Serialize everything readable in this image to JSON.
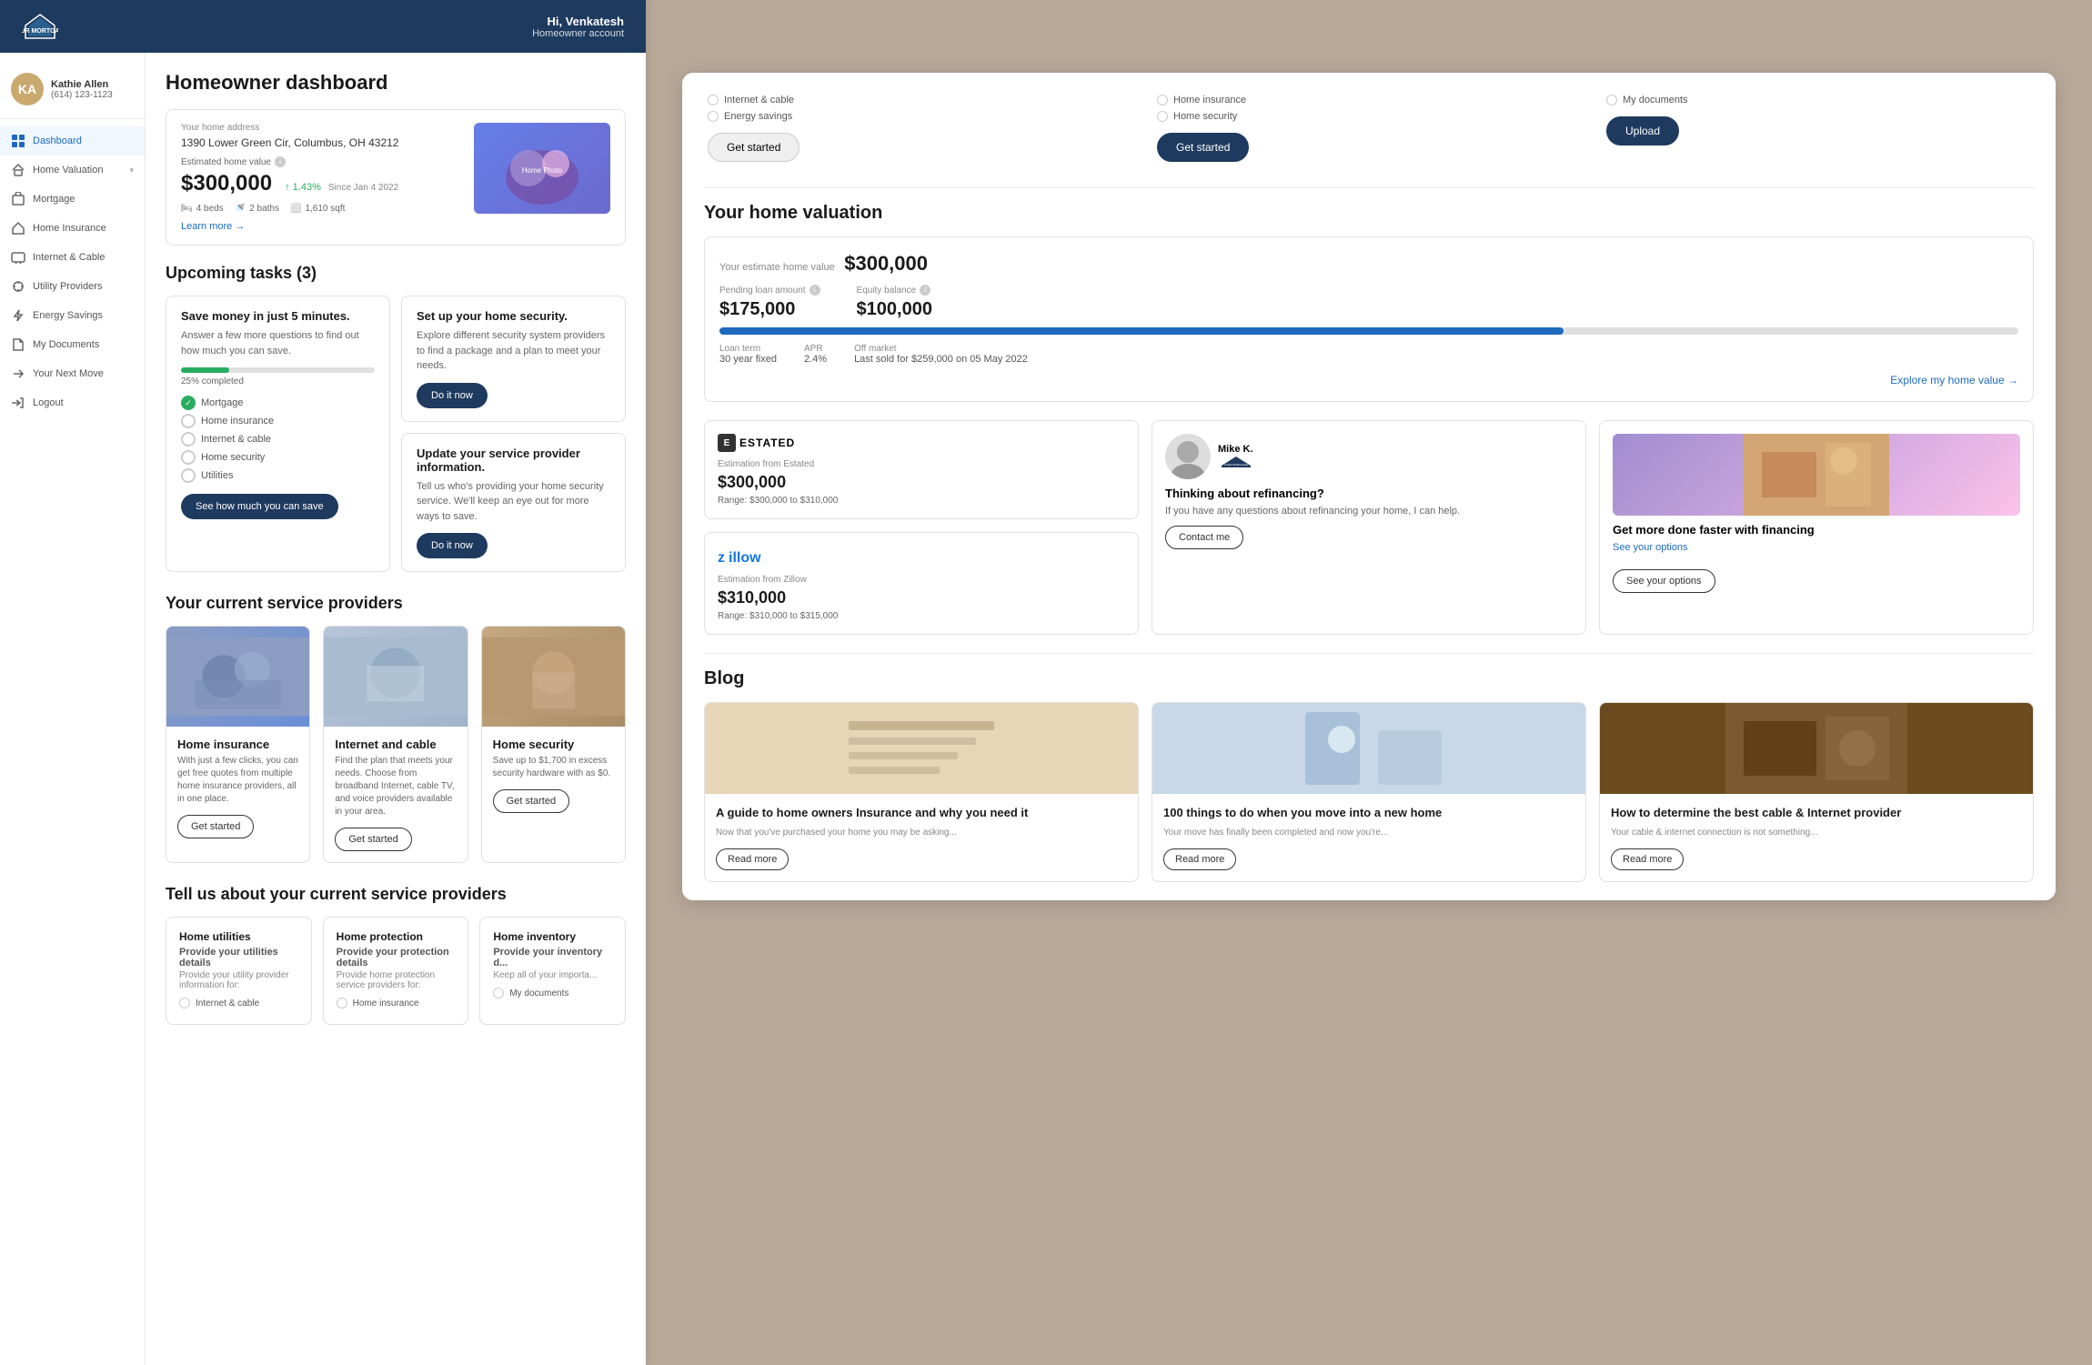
{
  "header": {
    "logo_text": "YOUR MORTGAGE",
    "greeting": "Hi, Venkatesh",
    "account_type": "Homeowner account"
  },
  "user": {
    "name": "Kathie Allen",
    "phone": "(614) 123-1123",
    "initials": "KA"
  },
  "nav": {
    "items": [
      {
        "id": "dashboard",
        "label": "Dashboard",
        "active": true
      },
      {
        "id": "home-valuation",
        "label": "Home Valuation",
        "has_chevron": true
      },
      {
        "id": "mortgage",
        "label": "Mortgage"
      },
      {
        "id": "home-insurance",
        "label": "Home Insurance"
      },
      {
        "id": "internet-cable",
        "label": "Internet & Cable"
      },
      {
        "id": "utility-providers",
        "label": "Utility Providers"
      },
      {
        "id": "energy-savings",
        "label": "Energy Savings"
      },
      {
        "id": "my-documents",
        "label": "My Documents"
      },
      {
        "id": "your-next-move",
        "label": "Your Next Move"
      },
      {
        "id": "logout",
        "label": "Logout"
      }
    ]
  },
  "dashboard": {
    "title": "Homeowner dashboard",
    "home": {
      "address_label": "Your home address",
      "address": "1390 Lower Green Cir, Columbus, OH 43212",
      "estimated_label": "Estimated home value",
      "value": "$300,000",
      "change": "1.43%",
      "change_direction": "up",
      "since": "Since Jan 4 2022",
      "beds": "4 beds",
      "baths": "2 baths",
      "sqft": "1,610 sqft",
      "learn_more": "Learn more →"
    },
    "tasks": {
      "section_title": "Upcoming tasks (3)",
      "card1": {
        "title": "Save money in just 5 minutes.",
        "desc": "Answer a few more questions to find out how much you can save.",
        "progress": 25,
        "progress_label": "25% completed",
        "checklist": [
          {
            "label": "Mortgage",
            "done": true
          },
          {
            "label": "Home insurance",
            "done": false
          },
          {
            "label": "Internet & cable",
            "done": false
          },
          {
            "label": "Home security",
            "done": false
          },
          {
            "label": "Utilities",
            "done": false
          }
        ],
        "cta": "See how much you can save"
      },
      "card2": {
        "title": "Set up your home security.",
        "desc": "Explore different security system providers to find a package and a plan to meet your needs.",
        "cta": "Do it now"
      },
      "card3": {
        "title": "Update your service provider information.",
        "desc": "Tell us who's providing your home security service. We'll keep an eye out for more ways to save.",
        "cta": "Do it now"
      }
    },
    "service_providers": {
      "section_title": "Your current service providers",
      "items": [
        {
          "name": "Home insurance",
          "desc": "With just a few clicks, you can get free quotes from multiple home insurance providers, all in one place.",
          "cta": "Get started",
          "color": "#8B9DC3"
        },
        {
          "name": "Internet and cable",
          "desc": "Find the plan that meets your needs. Choose from broadband Internet, cable TV, and voice providers available in your area.",
          "cta": "Get started",
          "color": "#B8C4D8"
        },
        {
          "name": "Home security",
          "desc": "Save up to $1,700 in excess security hardware with as $0.",
          "cta": "Get started",
          "color": "#C4A882"
        }
      ]
    },
    "tell_us": {
      "title": "Tell us about your current service providers",
      "cards": [
        {
          "title": "Home utilities",
          "subtitle": "Provide your utilities details",
          "desc": "Provide your utility provider information for:",
          "items": [
            "Internet & cable"
          ]
        },
        {
          "title": "Home protection",
          "subtitle": "Provide your protection details",
          "desc": "Provide home protection service providers for:",
          "items": [
            "Home insurance"
          ]
        },
        {
          "title": "Home inventory",
          "subtitle": "Provide your inventory d...",
          "desc": "Keep all of your importa...",
          "items": [
            "My documents"
          ]
        }
      ]
    }
  },
  "right_panel": {
    "top_services": [
      {
        "options": [
          "Internet & cable",
          "Energy savings"
        ],
        "cta": "Get started",
        "cta_style": "outline"
      },
      {
        "options": [
          "Home insurance",
          "Home security"
        ],
        "cta": "Get started",
        "cta_style": "dark"
      },
      {
        "options": [
          "My documents"
        ],
        "cta": "Upload",
        "cta_style": "dark"
      }
    ],
    "valuation": {
      "title": "Your home valuation",
      "estimate_label": "Your estimate home value",
      "estimate_value": "$300,000",
      "pending_loan_label": "Pending loan amount",
      "pending_loan": "$175,000",
      "equity_label": "Equity balance",
      "equity": "$100,000",
      "loan_term_label": "Loan term",
      "loan_term": "30 year fixed",
      "apr_label": "APR",
      "apr": "2.4%",
      "off_market_label": "Off market",
      "off_market": "Last sold for $259,000 on 05 May 2022",
      "explore_link": "Explore my home value →"
    },
    "sources": [
      {
        "logo": "ESTATED",
        "logo_color": "#333",
        "title": "Estimation from Estated",
        "value": "$300,000",
        "range": "Range: $300,000 to $310,000"
      },
      {
        "logo": "YOUR MORTGAGE",
        "logo_type": "advisor",
        "advisor_name": "Mike K.",
        "title": "Thinking about refinancing?",
        "desc": "If you have any questions about refinancing your home, I can help.",
        "cta": "Contact me"
      },
      {
        "logo": "financing",
        "title": "Get more done faster with financing",
        "desc": "See your options",
        "cta": "See your options"
      }
    ],
    "zillow": {
      "title": "Estimation from Zillow",
      "value": "$310,000",
      "range": "Range: $310,000 to $315,000"
    },
    "blog": {
      "title": "Blog",
      "articles": [
        {
          "title": "A guide to home owners Insurance and why you need it",
          "excerpt": "Now that you've purchased your home you may be asking...",
          "cta": "Read more",
          "color": "#e8d5b7"
        },
        {
          "title": "100 things to do when you move into a new home",
          "excerpt": "Your move has finally been completed and now you're...",
          "cta": "Read more",
          "color": "#c8d8e8"
        },
        {
          "title": "How to determine the best cable & Internet provider",
          "excerpt": "Your cable & internet connection is not something...",
          "cta": "Read more",
          "color": "#8B6914"
        }
      ]
    }
  }
}
